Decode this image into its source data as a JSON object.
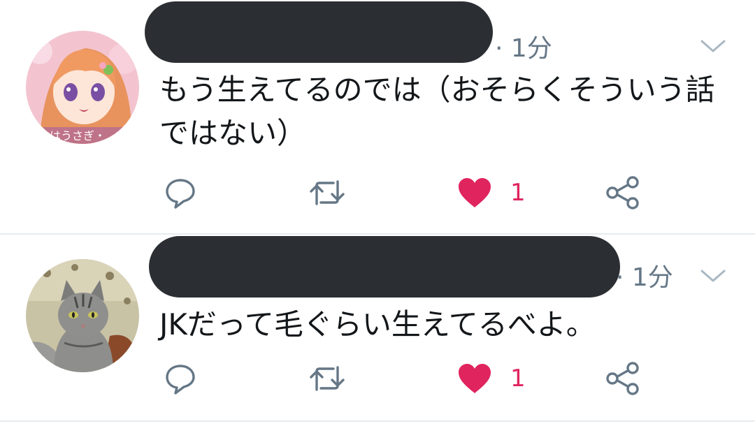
{
  "tweets": [
    {
      "time": "· 1分",
      "text": "もう生えてるのでは（おそらくそういう話ではない）",
      "like_count": "1",
      "avatar_icon": "anime-girl-avatar",
      "avatar_caption": "はうさぎ・"
    },
    {
      "time": "· 1分",
      "text": "JKだって毛ぐらい生えてるべよ。",
      "like_count": "1",
      "avatar_icon": "tabby-cat-avatar"
    }
  ],
  "icons": {
    "reply": "speech-bubble-icon",
    "retweet": "retweet-arrows-icon",
    "like": "heart-icon",
    "share": "share-nodes-icon",
    "more": "chevron-down-icon"
  },
  "colors": {
    "text": "#14171a",
    "muted": "#657786",
    "like_active": "#e0245e",
    "divider": "#e6ecf0",
    "redaction": "#2b2f33"
  }
}
